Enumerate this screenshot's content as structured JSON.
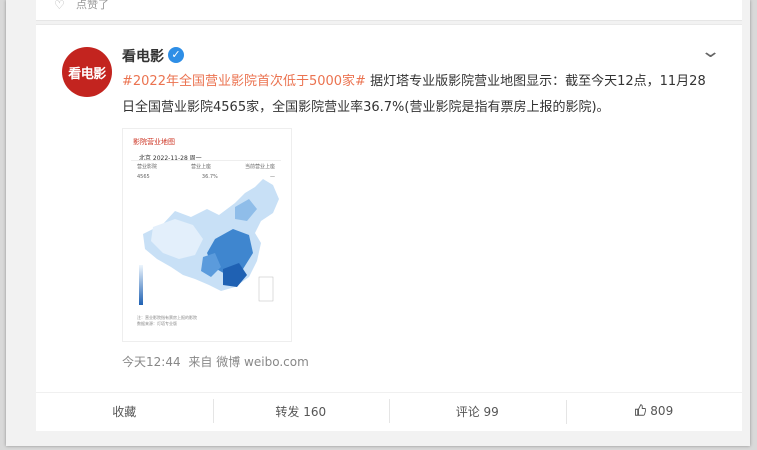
{
  "previous_post": {
    "snippet": "点赞了"
  },
  "post": {
    "author": "看电影",
    "avatar_text": "看电影",
    "hashtag": "#2022年全国营业影院首次低于5000家#",
    "body": " 据灯塔专业版影院营业地图显示：截至今天12点，11月28日全国营业影院4565家，全国影院营业率36.7%(营业影院是指有票房上报的影院)。",
    "timestamp": "今天12:44",
    "source": "来自 微博 weibo.com"
  },
  "attachment": {
    "title": "影院营业地图",
    "date_line": "北京 2022-11-28 周一"
  },
  "actions": {
    "favorite": "收藏",
    "repost": "转发 160",
    "comment": "评论 99",
    "like": "809"
  },
  "colors": {
    "accent_link": "#eb7350",
    "avatar_bg": "#c3241f",
    "verified_bg": "#2e8ee6"
  },
  "icons": {
    "verified": "verified-icon",
    "chevron": "chevron-down-icon",
    "like": "thumbs-up-icon"
  }
}
